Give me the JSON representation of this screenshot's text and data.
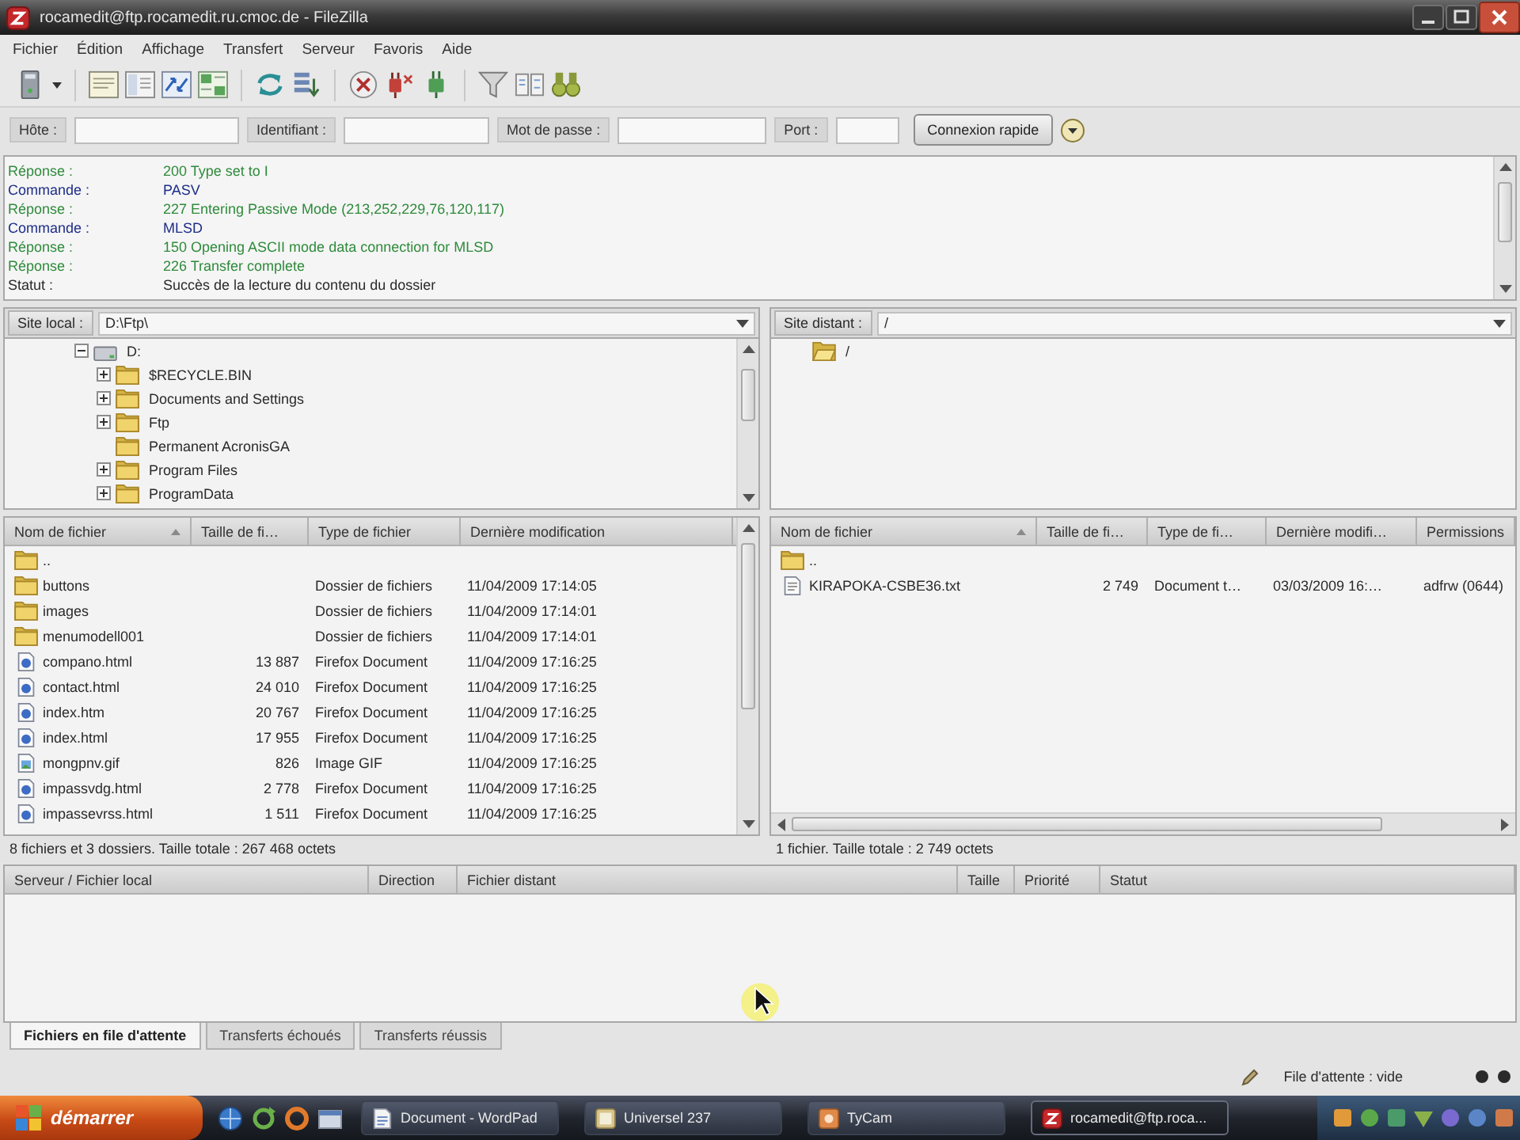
{
  "window": {
    "title": "rocamedit@ftp.rocamedit.ru.cmoc.de - FileZilla"
  },
  "menu": [
    "Fichier",
    "Édition",
    "Affichage",
    "Transfert",
    "Serveur",
    "Favoris",
    "Aide"
  ],
  "quickconnect": {
    "fields": [
      {
        "label": "Hôte :"
      },
      {
        "label": "Identifiant :"
      },
      {
        "label": "Mot de passe :"
      },
      {
        "label": "Port :"
      }
    ],
    "button": "Connexion rapide"
  },
  "log": [
    {
      "kind": "response",
      "label": "Réponse :",
      "text": "200 Type set to I"
    },
    {
      "kind": "command",
      "label": "Commande :",
      "text": "PASV"
    },
    {
      "kind": "response",
      "label": "Réponse :",
      "text": "227 Entering Passive Mode (213,252,229,76,120,117)"
    },
    {
      "kind": "command",
      "label": "Commande :",
      "text": "MLSD"
    },
    {
      "kind": "response",
      "label": "Réponse :",
      "text": "150 Opening ASCII mode data connection for MLSD"
    },
    {
      "kind": "response",
      "label": "Réponse :",
      "text": "226 Transfer complete"
    },
    {
      "kind": "status",
      "label": "Statut :",
      "text": "Succès de la lecture du contenu du dossier"
    }
  ],
  "local": {
    "site_label": "Site local :",
    "path": "D:\\Ftp\\",
    "tree": [
      {
        "label": "D:",
        "kind": "drive",
        "expanded": true,
        "has_children": true,
        "children": [
          {
            "label": "$RECYCLE.BIN",
            "kind": "folder",
            "expanded": false,
            "has_children": true
          },
          {
            "label": "Documents and Settings",
            "kind": "folder",
            "expanded": false,
            "has_children": true
          },
          {
            "label": "Ftp",
            "kind": "folder",
            "expanded": false,
            "has_children": true
          },
          {
            "label": "Permanent AcronisGA",
            "kind": "folder",
            "expanded": false,
            "has_children": false
          },
          {
            "label": "Program Files",
            "kind": "folder",
            "expanded": false,
            "has_children": true
          },
          {
            "label": "ProgramData",
            "kind": "folder",
            "expanded": false,
            "has_children": true
          }
        ]
      }
    ],
    "columns": [
      "Nom de fichier",
      "Taille de fi…",
      "Type de fichier",
      "Dernière modification"
    ],
    "rows": [
      {
        "kind": "parent",
        "name": ".."
      },
      {
        "kind": "folder",
        "name": "buttons",
        "type": "Dossier de fichiers",
        "modified": "11/04/2009 17:14:05"
      },
      {
        "kind": "folder",
        "name": "images",
        "type": "Dossier de fichiers",
        "modified": "11/04/2009 17:14:01"
      },
      {
        "kind": "folder",
        "name": "menumodell001",
        "type": "Dossier de fichiers",
        "modified": "11/04/2009 17:14:01"
      },
      {
        "kind": "html",
        "name": "compano.html",
        "size": "13 887",
        "type": "Firefox Document",
        "modified": "11/04/2009 17:16:25"
      },
      {
        "kind": "html",
        "name": "contact.html",
        "size": "24 010",
        "type": "Firefox Document",
        "modified": "11/04/2009 17:16:25"
      },
      {
        "kind": "html",
        "name": "index.htm",
        "size": "20 767",
        "type": "Firefox Document",
        "modified": "11/04/2009 17:16:25"
      },
      {
        "kind": "html",
        "name": "index.html",
        "size": "17 955",
        "type": "Firefox Document",
        "modified": "11/04/2009 17:16:25"
      },
      {
        "kind": "gif",
        "name": "mongpnv.gif",
        "size": "826",
        "type": "Image GIF",
        "modified": "11/04/2009 17:16:25"
      },
      {
        "kind": "html",
        "name": "impassvdg.html",
        "size": "2 778",
        "type": "Firefox Document",
        "modified": "11/04/2009 17:16:25"
      },
      {
        "kind": "html",
        "name": "impassevrss.html",
        "size": "1 511",
        "type": "Firefox Document",
        "modified": "11/04/2009 17:16:25"
      }
    ],
    "status": "8 fichiers et 3 dossiers. Taille totale : 267 468 octets"
  },
  "remote": {
    "site_label": "Site distant :",
    "path": "/",
    "tree": [
      {
        "label": "/",
        "kind": "folder",
        "expanded": true,
        "has_children": false
      }
    ],
    "columns": [
      "Nom de fichier",
      "Taille de fi…",
      "Type de fi…",
      "Dernière modifi…",
      "Permissions"
    ],
    "rows": [
      {
        "kind": "parent",
        "name": ".."
      },
      {
        "kind": "text",
        "name": "KIRAPOKA-CSBE36.txt",
        "size": "2 749",
        "type": "Document t…",
        "modified": "03/03/2009 16:…",
        "permissions": "adfrw (0644)"
      }
    ],
    "status": "1 fichier. Taille totale : 2 749 octets"
  },
  "queue": {
    "columns": [
      "Serveur / Fichier local",
      "Direction",
      "Fichier distant",
      "Taille",
      "Priorité",
      "Statut"
    ],
    "tabs": [
      {
        "label": "Fichiers en file d'attente",
        "selected": true
      },
      {
        "label": "Transferts échoués",
        "selected": false
      },
      {
        "label": "Transferts réussis",
        "selected": false
      }
    ],
    "status": "File d'attente : vide"
  },
  "taskbar": {
    "start": "démarrer",
    "tasks": [
      {
        "kind": "document",
        "label": "Document - WordPad",
        "selected": false
      },
      {
        "kind": "app",
        "label": "Universel 237",
        "selected": false
      },
      {
        "kind": "image",
        "label": "TyCam",
        "selected": false
      },
      {
        "kind": "filezilla",
        "label": "rocamedit@ftp.roca...",
        "selected": true
      }
    ]
  }
}
